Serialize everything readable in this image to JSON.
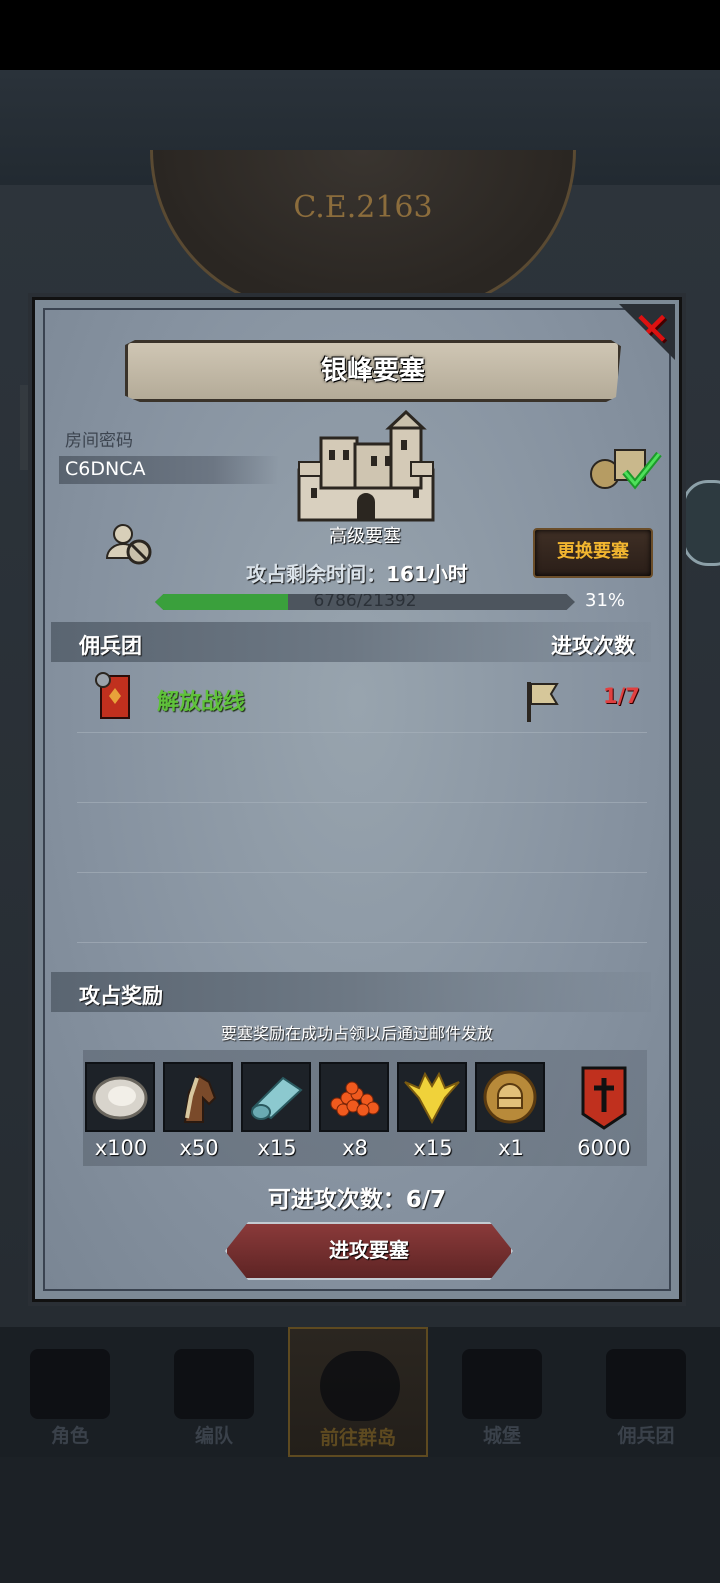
{
  "background": {
    "year": "C.E.2163"
  },
  "modal": {
    "title": "银峰要塞",
    "room_code_label": "房间密码",
    "room_code": "C6DNCA",
    "fortress_grade": "高级要塞",
    "change_fortress_label": "更换要塞",
    "time_label": "攻占剩余时间：",
    "time_value": "161小时",
    "progress": {
      "text": "6786/21392",
      "current": 6786,
      "total": 21392,
      "percent_text": "31%"
    },
    "mercenary_header": "佣兵团",
    "attack_count_header": "进攻次数",
    "mercenaries": [
      {
        "name": "解放战线",
        "attacks": "1/7"
      }
    ],
    "reward_header": "攻占奖励",
    "reward_desc": "要塞奖励在成功占领以后通过邮件发放",
    "rewards": [
      {
        "icon": "oyster-icon",
        "qty": "x100"
      },
      {
        "icon": "horse-icon",
        "qty": "x50"
      },
      {
        "icon": "cloth-icon",
        "qty": "x15"
      },
      {
        "icon": "roe-icon",
        "qty": "x8"
      },
      {
        "icon": "gold-crest-icon",
        "qty": "x15"
      },
      {
        "icon": "helmet-coin-icon",
        "qty": "x1"
      },
      {
        "icon": "guild-banner-icon",
        "qty": "6000"
      }
    ],
    "attackable_label": "可进攻次数：",
    "attackable_value": "6/7",
    "attack_button": "进攻要塞"
  },
  "nav": {
    "items": [
      {
        "label": "角色"
      },
      {
        "label": "编队"
      },
      {
        "label": "前往群岛"
      },
      {
        "label": "城堡"
      },
      {
        "label": "佣兵团"
      }
    ],
    "active_index": 2
  },
  "colors": {
    "accent_gold": "#f2b630",
    "merc_green": "#5fc23a",
    "progress_green": "#3aa03c",
    "count_red": "#e04040",
    "close_red": "#dd1111"
  }
}
